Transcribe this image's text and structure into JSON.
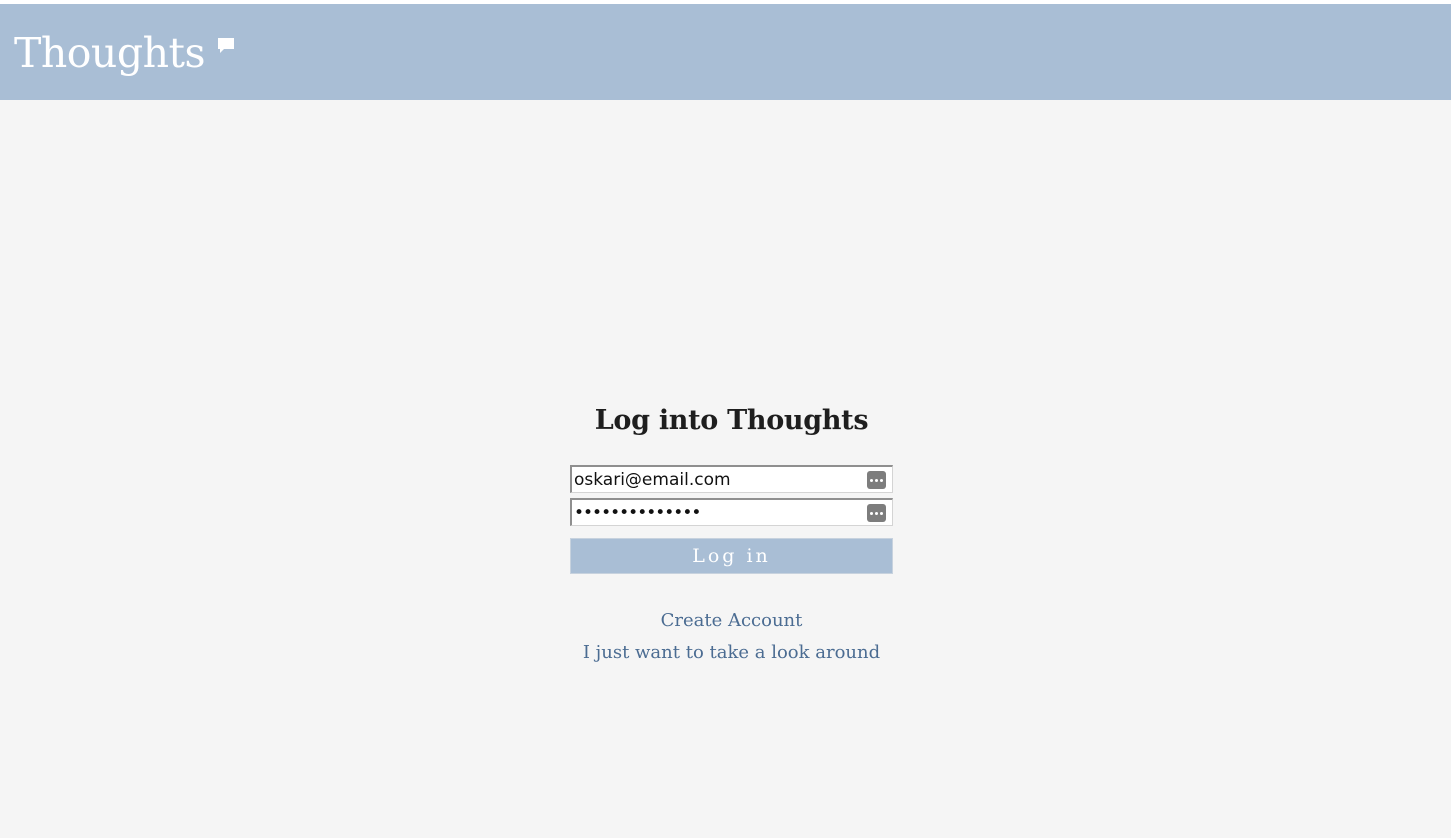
{
  "header": {
    "brand": "Thoughts",
    "brand_icon": "speech-bubble-icon",
    "background_color": "#a9bed5"
  },
  "login": {
    "title": "Log into Thoughts",
    "email": {
      "value": "oskari@email.com",
      "icon": "keychain-autofill-icon"
    },
    "password": {
      "value": "••••••••••••••",
      "icon": "keychain-autofill-icon"
    },
    "submit_label": "Log in"
  },
  "links": {
    "create_account": "Create Account",
    "look_around": "I just want to take a look around"
  },
  "colors": {
    "accent": "#a9bed5",
    "link": "#4b6c92",
    "background": "#f5f5f5"
  }
}
